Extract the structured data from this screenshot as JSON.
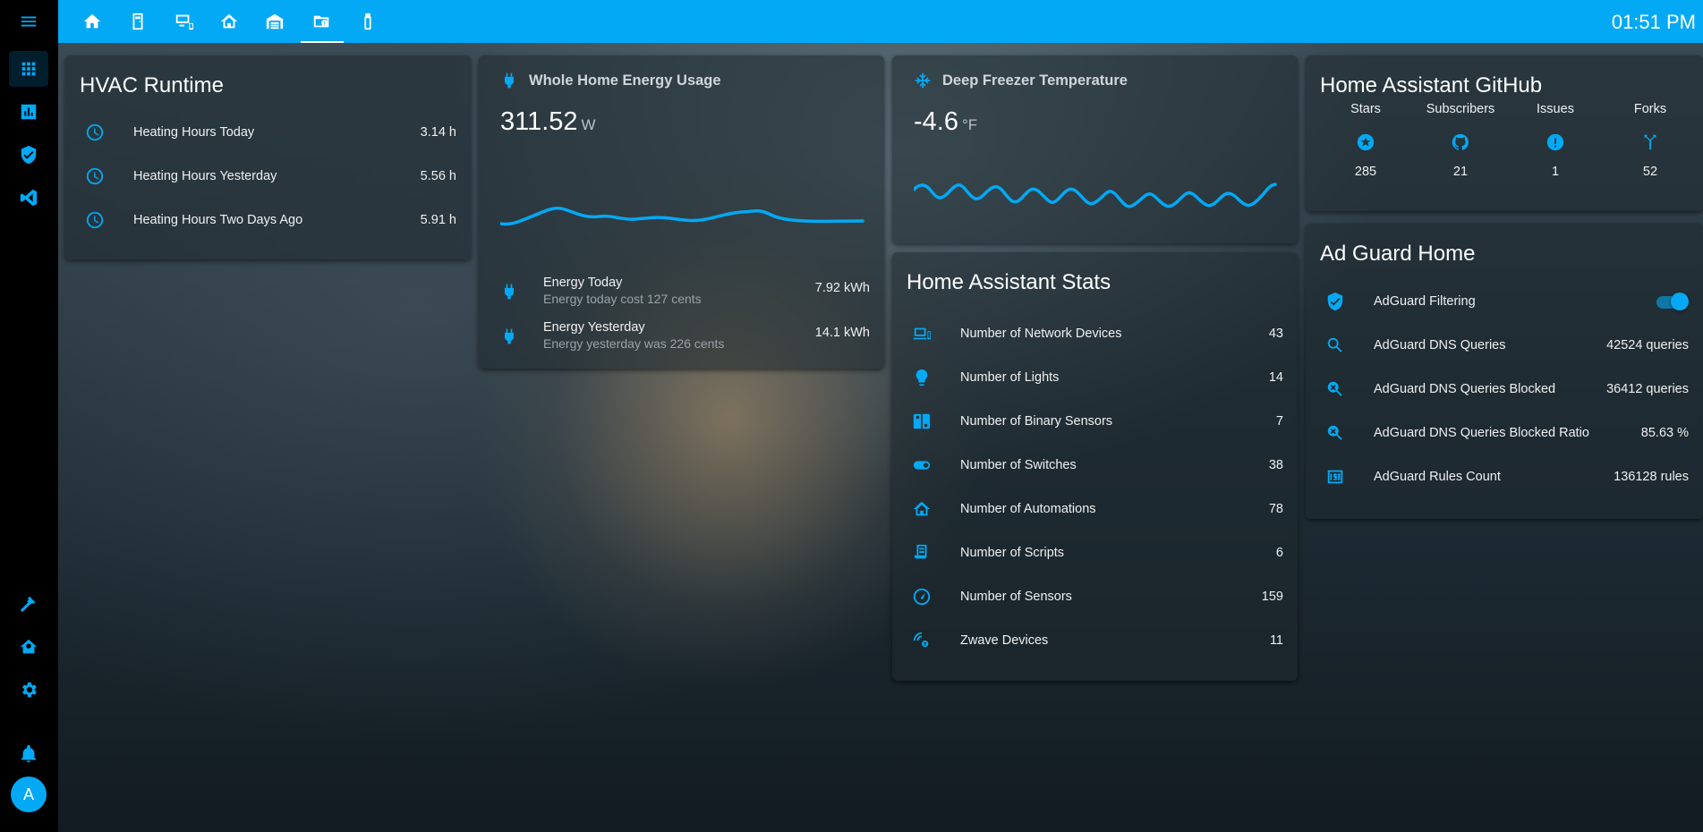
{
  "topbar": {
    "tabs": [
      {
        "icon": "home-icon"
      },
      {
        "icon": "door-icon"
      },
      {
        "icon": "devices-icon"
      },
      {
        "icon": "home-automation-icon"
      },
      {
        "icon": "garage-icon"
      },
      {
        "icon": "folder-info-icon"
      },
      {
        "icon": "bulb-icon"
      }
    ],
    "active_tab": 5,
    "clock": "01:51 PM"
  },
  "sidebar": {
    "items": [
      "menu-icon",
      "apps-icon",
      "chart-icon",
      "shield-check-icon",
      "vscode-icon"
    ],
    "bottom_items": [
      "hammer-icon",
      "home-tools-icon",
      "gear-icon",
      "bell-icon"
    ],
    "avatar": "A"
  },
  "hvac": {
    "title": "HVAC Runtime",
    "rows": [
      {
        "label": "Heating Hours Today",
        "value": "3.14 h"
      },
      {
        "label": "Heating Hours Yesterday",
        "value": "5.56 h"
      },
      {
        "label": "Heating Hours Two Days Ago",
        "value": "5.91 h"
      }
    ]
  },
  "energy": {
    "title": "Whole Home Energy Usage",
    "value": "311.52",
    "unit": "W",
    "rows": [
      {
        "label": "Energy Today",
        "secondary": "Energy today cost 127 cents",
        "value": "7.92 kWh"
      },
      {
        "label": "Energy Yesterday",
        "secondary": "Energy yesterday was 226 cents",
        "value": "14.1 kWh"
      }
    ]
  },
  "freezer": {
    "title": "Deep Freezer Temperature",
    "value": "-4.6",
    "unit": "°F"
  },
  "ha_stats": {
    "title": "Home Assistant Stats",
    "rows": [
      {
        "label": "Number of Network Devices",
        "value": "43",
        "icon": "devices-icon"
      },
      {
        "label": "Number of Lights",
        "value": "14",
        "icon": "bulb-icon"
      },
      {
        "label": "Number of Binary Sensors",
        "value": "7",
        "icon": "switch-console-icon"
      },
      {
        "label": "Number of Switches",
        "value": "38",
        "icon": "toggle-icon"
      },
      {
        "label": "Number of Automations",
        "value": "78",
        "icon": "home-automation-icon"
      },
      {
        "label": "Number of Scripts",
        "value": "6",
        "icon": "script-icon"
      },
      {
        "label": "Number of Sensors",
        "value": "159",
        "icon": "gauge-icon"
      },
      {
        "label": "Zwave Devices",
        "value": "11",
        "icon": "zwave-icon"
      }
    ]
  },
  "github": {
    "title": "Home Assistant GitHub",
    "cols": [
      {
        "label": "Stars",
        "value": "285",
        "icon": "star-circle-icon"
      },
      {
        "label": "Subscribers",
        "value": "21",
        "icon": "github-icon"
      },
      {
        "label": "Issues",
        "value": "1",
        "icon": "alert-circle-icon"
      },
      {
        "label": "Forks",
        "value": "52",
        "icon": "fork-icon"
      }
    ]
  },
  "adguard": {
    "title": "Ad Guard Home",
    "toggle_label": "AdGuard Filtering",
    "toggle_on": true,
    "rows": [
      {
        "label": "AdGuard DNS Queries",
        "value": "42524 queries",
        "icon": "magnify-icon"
      },
      {
        "label": "AdGuard DNS Queries Blocked",
        "value": "36412 queries",
        "icon": "magnify-close-icon"
      },
      {
        "label": "AdGuard DNS Queries Blocked Ratio",
        "value": "85.63 %",
        "icon": "magnify-close-icon"
      },
      {
        "label": "AdGuard Rules Count",
        "value": "136128 rules",
        "icon": "counter-icon"
      }
    ]
  },
  "colors": {
    "accent": "#03a9f4",
    "sidebar": "#000000"
  }
}
